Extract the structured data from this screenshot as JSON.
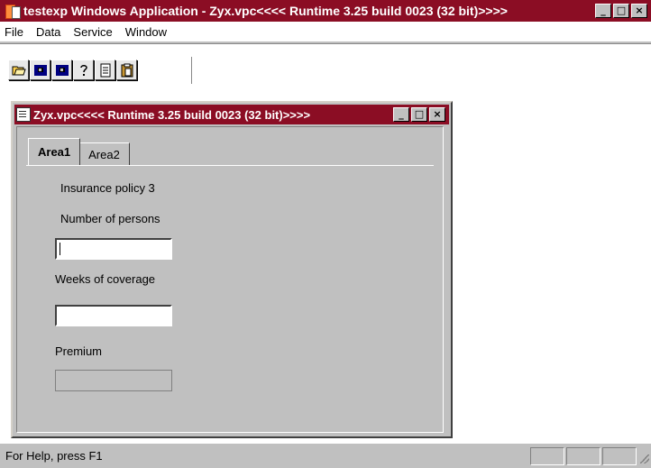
{
  "app": {
    "title": "testexp Windows Application - Zyx.vpc<<<< Runtime 3.25 build 0023 (32 bit)>>>>",
    "buttons": {
      "minimize": "_",
      "maximize": "□",
      "close": "×"
    }
  },
  "menu": [
    "File",
    "Data",
    "Service",
    "Window"
  ],
  "toolbar": {
    "buttons": [
      {
        "name": "open-icon",
        "glyph": "📂"
      },
      {
        "name": "record-icon",
        "glyph": "■"
      },
      {
        "name": "record2-icon",
        "glyph": "■"
      },
      {
        "name": "help-icon",
        "glyph": "?"
      },
      {
        "name": "document-icon",
        "glyph": "▤"
      },
      {
        "name": "clipboard-icon",
        "glyph": "📋"
      }
    ]
  },
  "child": {
    "title": "Zyx.vpc<<<< Runtime 3.25 build 0023 (32 bit)>>>>",
    "tabs": [
      "Area1",
      "Area2"
    ],
    "form": {
      "heading": "Insurance policy 3",
      "persons_label": "Number of persons",
      "persons_value": "",
      "weeks_label": "Weeks of coverage",
      "weeks_value": "",
      "premium_label": "Premium",
      "premium_value": ""
    }
  },
  "status": {
    "text": "For Help, press F1"
  },
  "colors": {
    "titlebar": "#8b0d24",
    "face": "#c0c0c0"
  }
}
